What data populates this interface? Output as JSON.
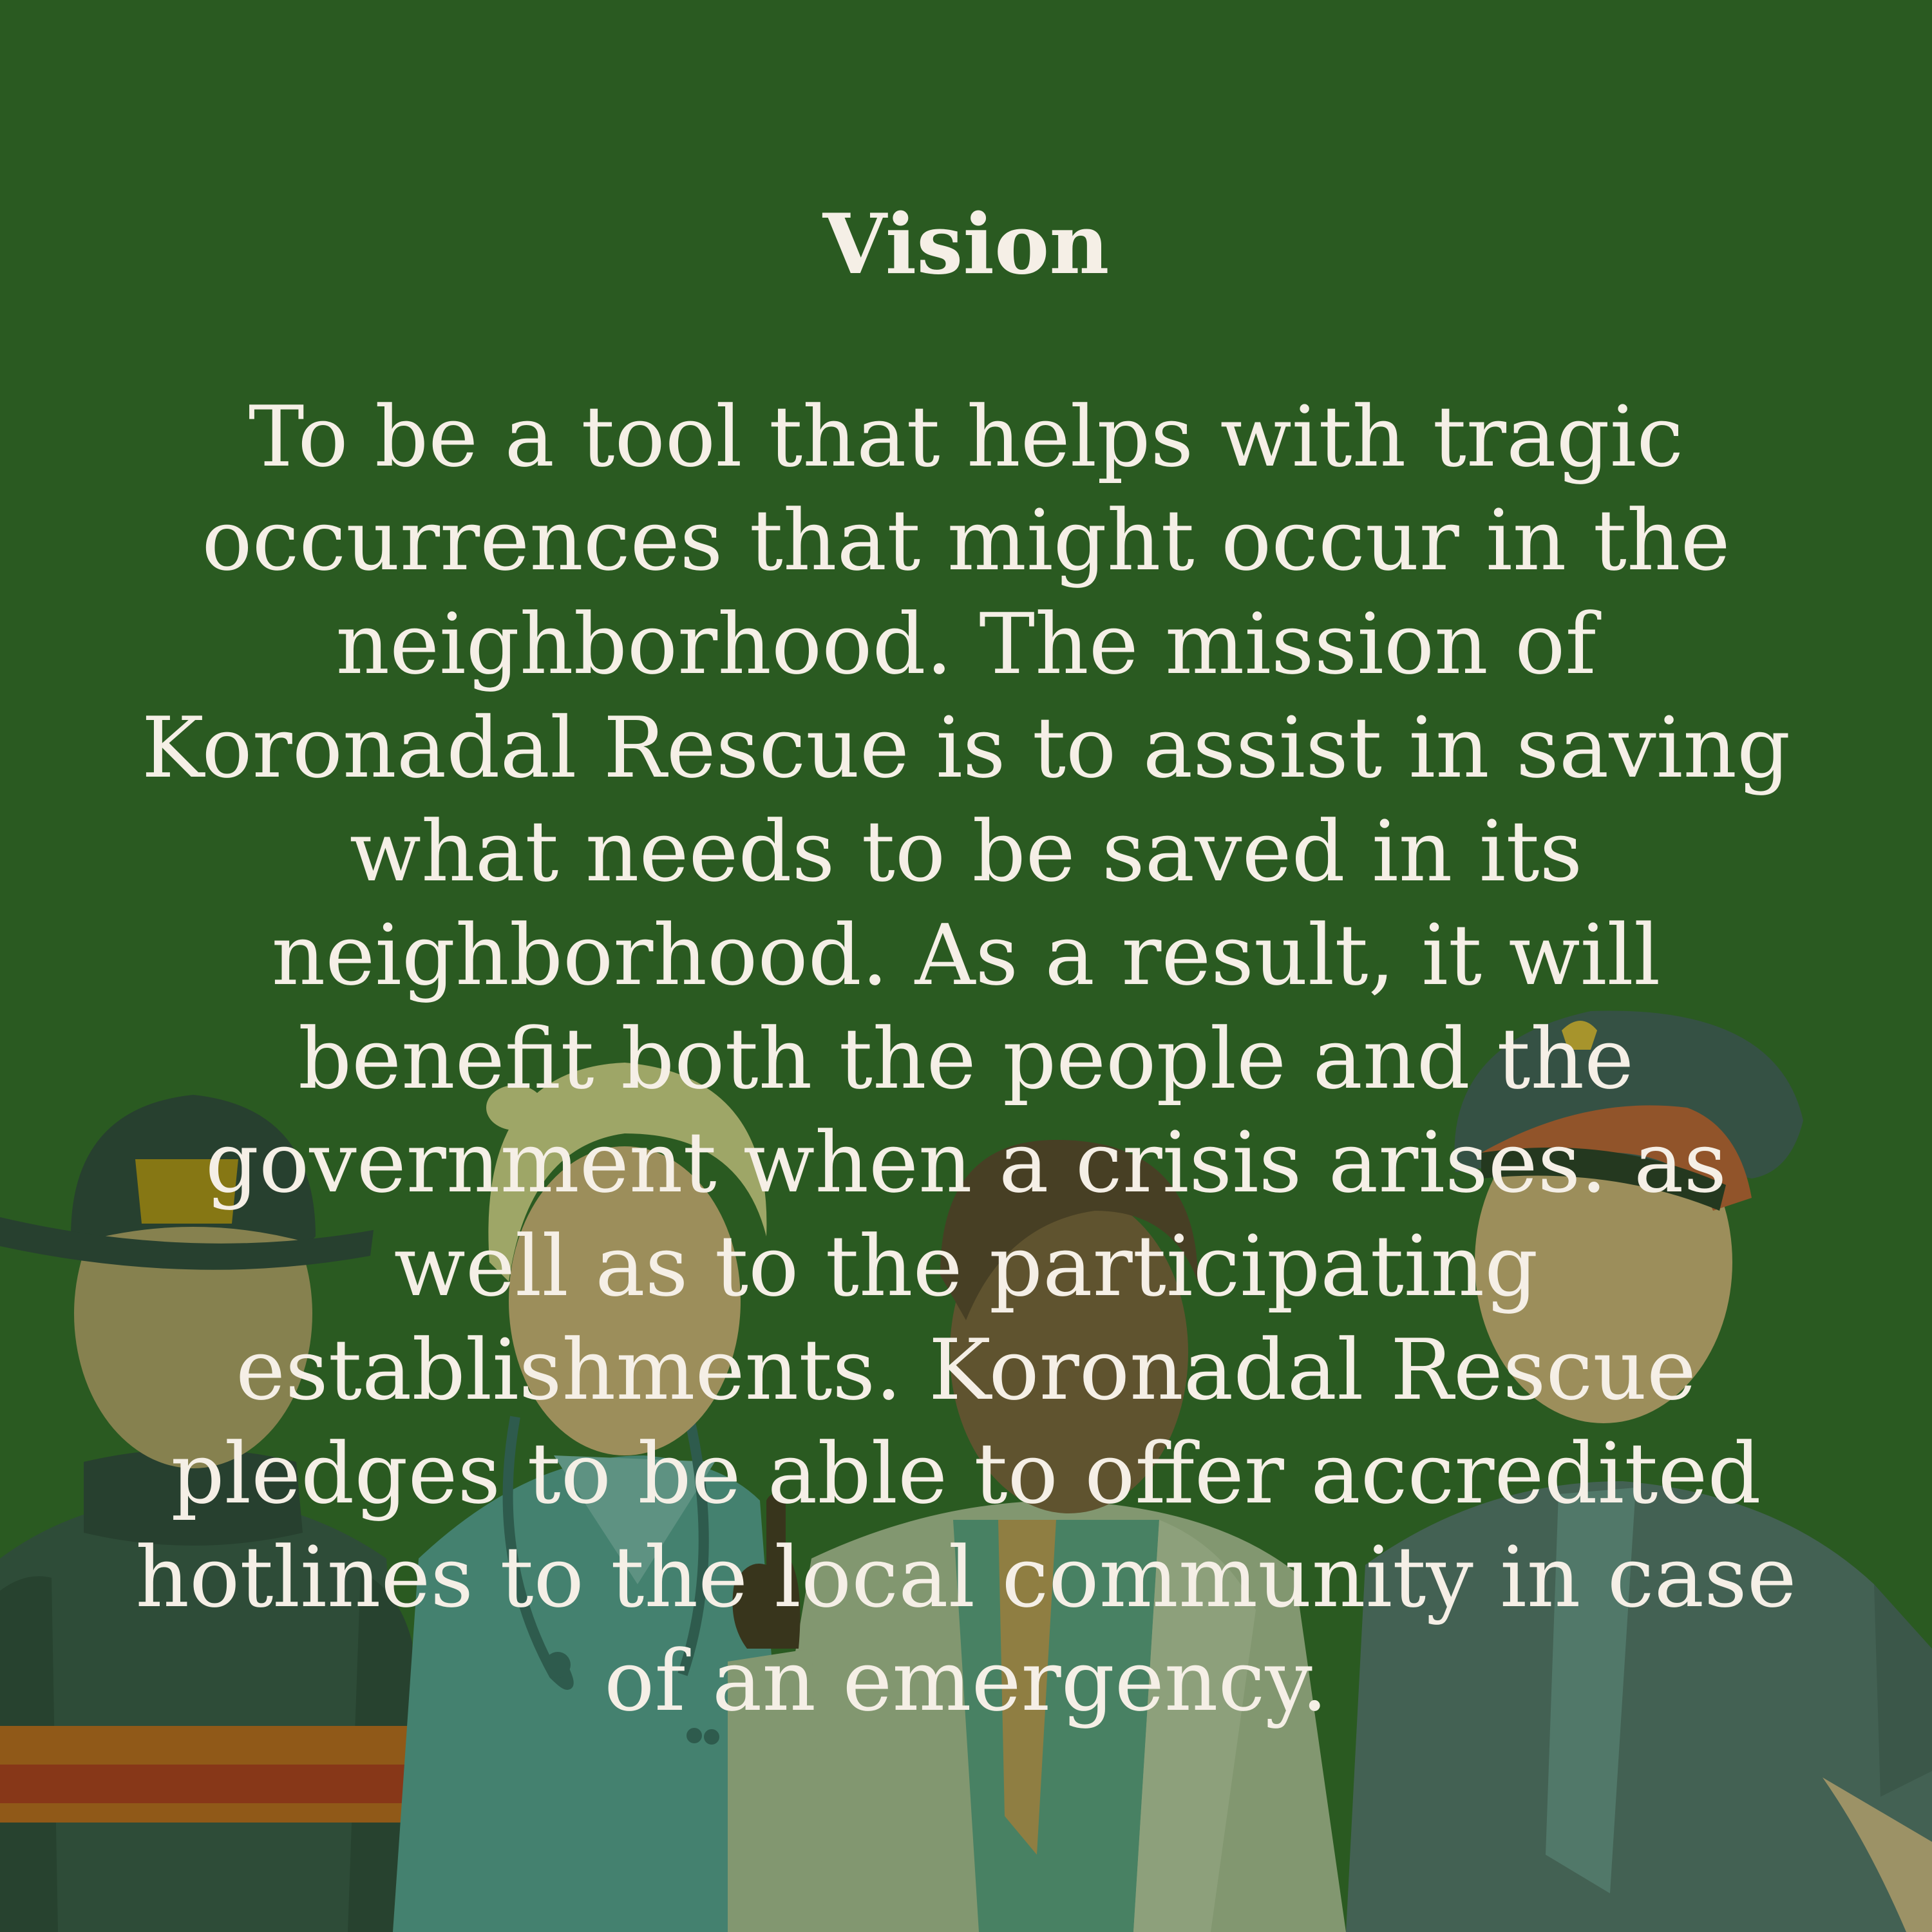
{
  "slide": {
    "title": "Vision",
    "body": "To be a tool that helps with tragic occurrences that might occur in the neighborhood. The mission of Koronadal Rescue is to assist in saving what needs to be saved in its neighborhood. As a result, it will benefit both the people and the government when a crisis arises. as well as to the participating establishments. Koronadal Rescue pledges to be able to offer accredited hotlines to the local community in case of an emergency."
  },
  "colors": {
    "background": "#2a5b21",
    "text": "#f5efe6"
  },
  "illustration": {
    "figures": [
      "firefighter",
      "nurse",
      "doctor",
      "police-officer"
    ]
  }
}
